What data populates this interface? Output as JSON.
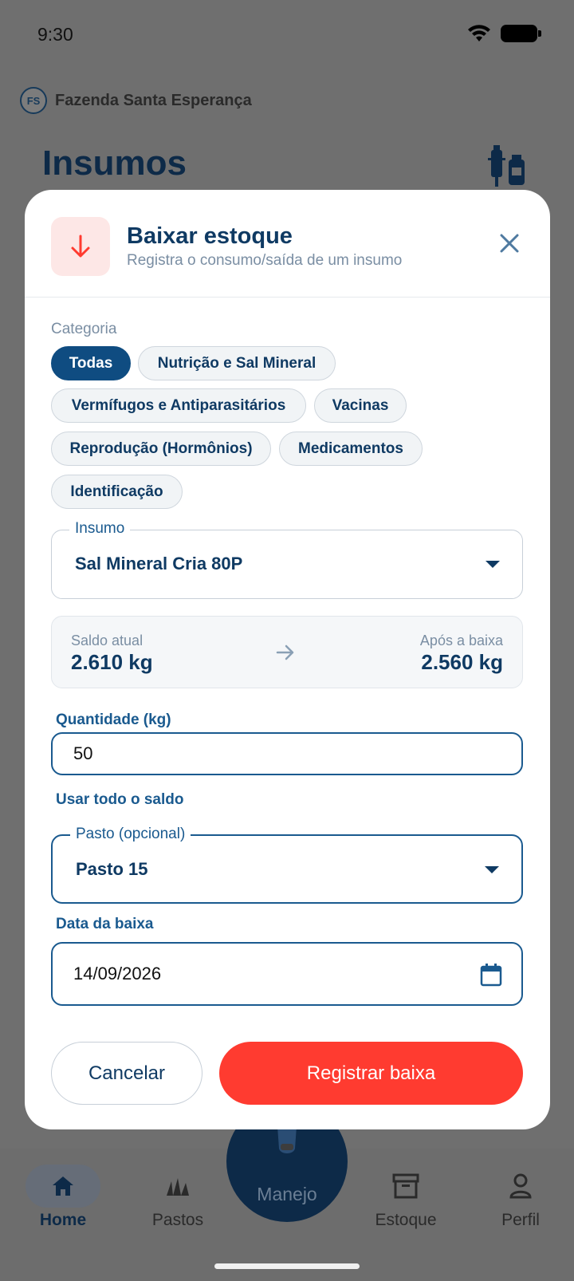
{
  "status_bar": {
    "time": "9:30"
  },
  "header": {
    "farm_initials": "FS",
    "farm_name": "Fazenda Santa Esperança",
    "page_title": "Insumos"
  },
  "modal": {
    "title": "Baixar estoque",
    "subtitle": "Registra o consumo/saída de um insumo",
    "category_label": "Categoria",
    "categories": [
      {
        "label": "Todas",
        "active": true
      },
      {
        "label": "Nutrição e Sal Mineral",
        "active": false
      },
      {
        "label": "Vermífugos e Antiparasitários",
        "active": false
      },
      {
        "label": "Vacinas",
        "active": false
      },
      {
        "label": "Reprodução (Hormônios)",
        "active": false
      },
      {
        "label": "Medicamentos",
        "active": false
      },
      {
        "label": "Identificação",
        "active": false
      }
    ],
    "insumo": {
      "label": "Insumo",
      "value": "Sal Mineral Cria 80P"
    },
    "balance": {
      "current_label": "Saldo atual",
      "current_value": "2.610 kg",
      "after_label": "Após a baixa",
      "after_value": "2.560 kg"
    },
    "quantity": {
      "label": "Quantidade (kg)",
      "value": "50"
    },
    "use_all_link": "Usar todo o saldo",
    "pasto": {
      "label": "Pasto (opcional)",
      "value": "Pasto 15"
    },
    "date": {
      "label": "Data da baixa",
      "value": "14/09/2026"
    },
    "cancel_label": "Cancelar",
    "submit_label": "Registrar baixa"
  },
  "bottom_nav": {
    "home": "Home",
    "pastos": "Pastos",
    "center": "Manejo",
    "estoque": "Estoque",
    "perfil": "Perfil"
  },
  "colors": {
    "primary": "#0f4c81",
    "danger": "#ff3b30",
    "text_dark": "#0f3a63",
    "muted": "#7a8ea3"
  }
}
